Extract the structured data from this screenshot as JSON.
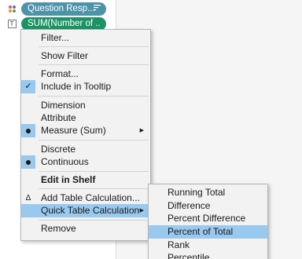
{
  "shelf": {
    "pills": [
      {
        "label": "Question Resp...",
        "sort_icon": "sort-descending-icon",
        "shelf_icon": "color-dots-icon"
      },
      {
        "label": "SUM(Number of ..",
        "shelf_icon": "tooltip-icon"
      }
    ]
  },
  "menu": {
    "items": [
      {
        "label": "Filter..."
      },
      {
        "label": "Show Filter"
      },
      {
        "label": "Format..."
      },
      {
        "label": "Include in Tooltip",
        "mark": "check"
      },
      {
        "label": "Dimension"
      },
      {
        "label": "Attribute"
      },
      {
        "label": "Measure (Sum)",
        "mark": "dot",
        "submenu": true
      },
      {
        "label": "Discrete"
      },
      {
        "label": "Continuous",
        "mark": "dot"
      },
      {
        "label": "Edit in Shelf"
      },
      {
        "label": "Add Table Calculation...",
        "mark": "delta"
      },
      {
        "label": "Quick Table Calculation",
        "submenu": true,
        "highlighted": true
      },
      {
        "label": "Remove"
      }
    ]
  },
  "submenu": {
    "items": [
      {
        "label": "Running Total"
      },
      {
        "label": "Difference"
      },
      {
        "label": "Percent Difference"
      },
      {
        "label": "Percent of Total",
        "highlighted": true
      },
      {
        "label": "Rank"
      },
      {
        "label": "Percentile"
      }
    ]
  },
  "glyphs": {
    "check": "✓",
    "delta": "Δ",
    "arrow": "▶",
    "sort": "☰",
    "tooltip_box": "T"
  },
  "colors": {
    "pill_blue": "#4d93a8",
    "pill_green": "#1a9464",
    "highlight": "#99c9ef"
  }
}
